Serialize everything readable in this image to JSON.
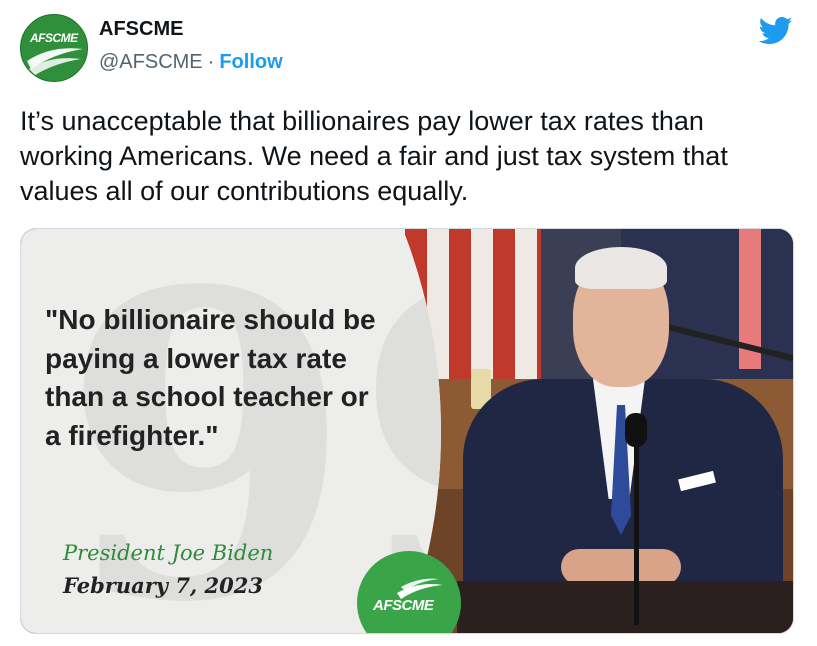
{
  "account": {
    "name": "AFSCME",
    "handle": "@AFSCME",
    "separator": "·",
    "follow_label": "Follow",
    "avatar_text": "AFSCME"
  },
  "tweet": {
    "text": "It’s unacceptable that billionaires pay lower tax rates than working Americans. We need a fair and just tax system that values all of our contributions equally."
  },
  "media": {
    "quote": "\"No billionaire should be paying a lower tax rate than a school teacher or a firefighter.\"",
    "attribution_name": "President Joe Biden",
    "attribution_date": "February 7, 2023",
    "logo_text": "AFSCME",
    "quote_glyph": "99"
  },
  "colors": {
    "follow": "#1d9bf0",
    "twitter_blue": "#1d9bf0",
    "brand_green": "#3aa548",
    "attribution_green": "#2e8b3a"
  },
  "icons": {
    "platform": "twitter-bird-icon"
  }
}
